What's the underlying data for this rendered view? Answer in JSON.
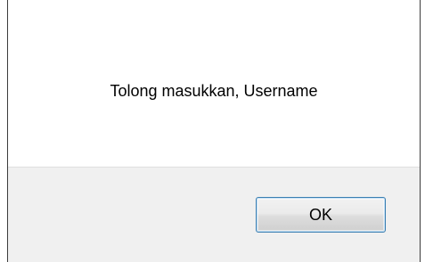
{
  "dialog": {
    "message": "Tolong masukkan, Username",
    "ok_label": "OK"
  }
}
